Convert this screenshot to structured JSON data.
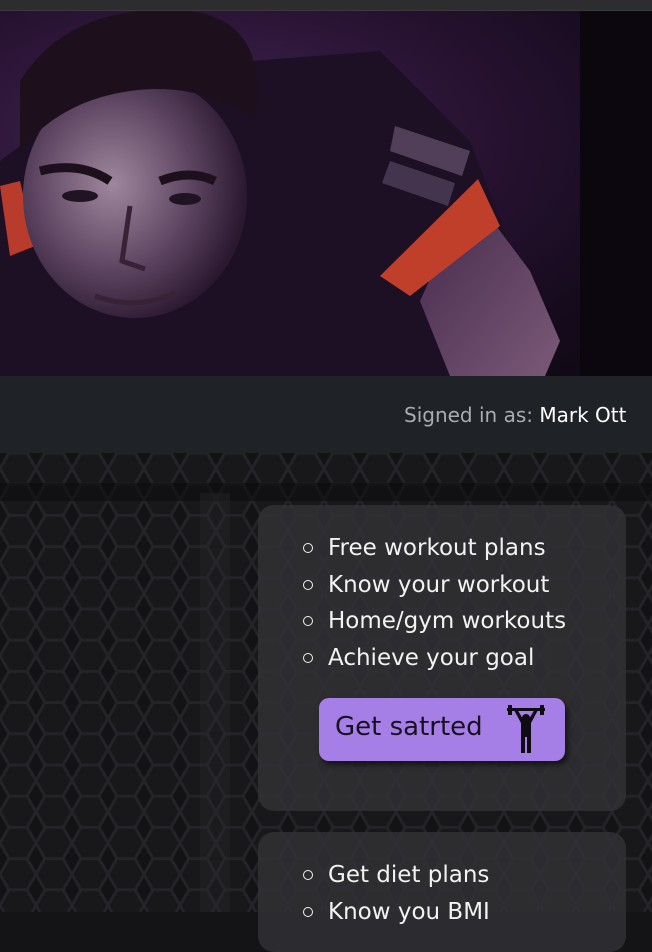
{
  "hero": {
    "image": "person-in-dark-purple-gym-photo"
  },
  "signin": {
    "label": "Signed in as:",
    "user": "Mark Ott"
  },
  "card1": {
    "features": [
      "Free workout plans",
      "Know your workout",
      "Home/gym workouts",
      "Achieve your goal"
    ],
    "cta_label": "Get satrted",
    "cta_icon": "weightlifter-icon"
  },
  "card2": {
    "features": [
      "Get diet plans",
      "Know you BMI"
    ]
  },
  "colors": {
    "accent": "#a57ee6",
    "bar": "#1f2226",
    "card": "#323236"
  }
}
